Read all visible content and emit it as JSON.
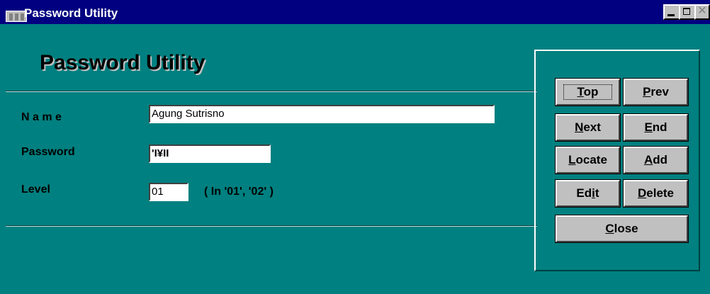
{
  "window": {
    "title": "Password Utility",
    "icon": "window-app-icon",
    "controls": {
      "minimize": "_",
      "maximize": "□",
      "close": "✕"
    }
  },
  "app_title": "Password Utility",
  "form": {
    "name_label": "N a m e",
    "name_value": "Agung Sutrisno",
    "password_label": "Password",
    "password_value": "'I¥II",
    "level_label": "Level",
    "level_value": "01",
    "level_hint": "( In '01', '02' )"
  },
  "buttons": {
    "top": {
      "hot": "T",
      "rest": "op"
    },
    "prev": {
      "hot": "P",
      "rest": "rev"
    },
    "next": {
      "hot": "N",
      "rest": "ext"
    },
    "end": {
      "hot": "E",
      "rest": "nd"
    },
    "locate": {
      "hot": "L",
      "rest": "ocate"
    },
    "add": {
      "hot": "A",
      "rest": "dd"
    },
    "edit": {
      "pre": "Ed",
      "hot": "i",
      "rest": "t"
    },
    "delete": {
      "hot": "D",
      "rest": "elete"
    },
    "close": {
      "hot": "C",
      "rest": "lose"
    }
  },
  "colors": {
    "window_bg": "#008080",
    "title_bar": "#000080",
    "button_face": "#c0c0c0"
  }
}
